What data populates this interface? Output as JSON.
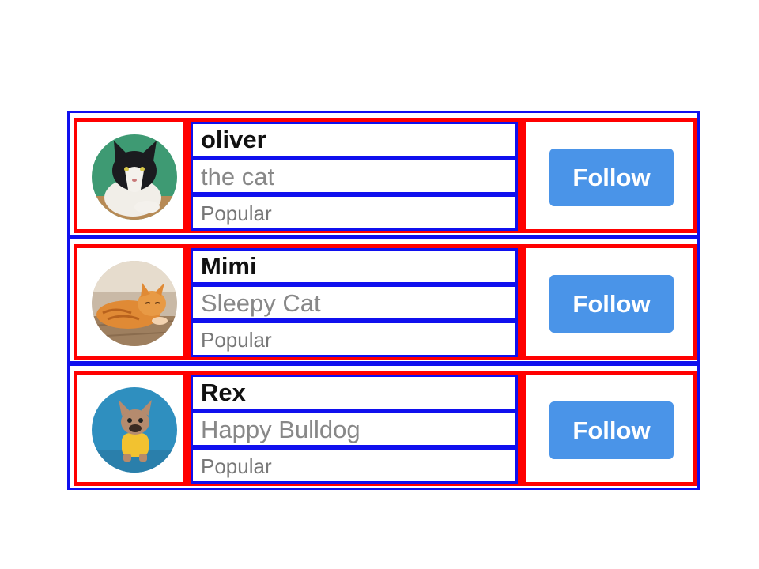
{
  "users": [
    {
      "name": "oliver",
      "subtitle": "the cat",
      "tag": "Popular",
      "follow_label": "Follow",
      "avatar_icon": "cat-avatar-icon"
    },
    {
      "name": "Mimi",
      "subtitle": "Sleepy Cat",
      "tag": "Popular",
      "follow_label": "Follow",
      "avatar_icon": "orange-cat-avatar-icon"
    },
    {
      "name": "Rex",
      "subtitle": "Happy Bulldog",
      "tag": "Popular",
      "follow_label": "Follow",
      "avatar_icon": "bulldog-avatar-icon"
    }
  ],
  "colors": {
    "button": "#4a94e8",
    "outer_border": "#1010ee",
    "cell_border": "#ff0000"
  }
}
